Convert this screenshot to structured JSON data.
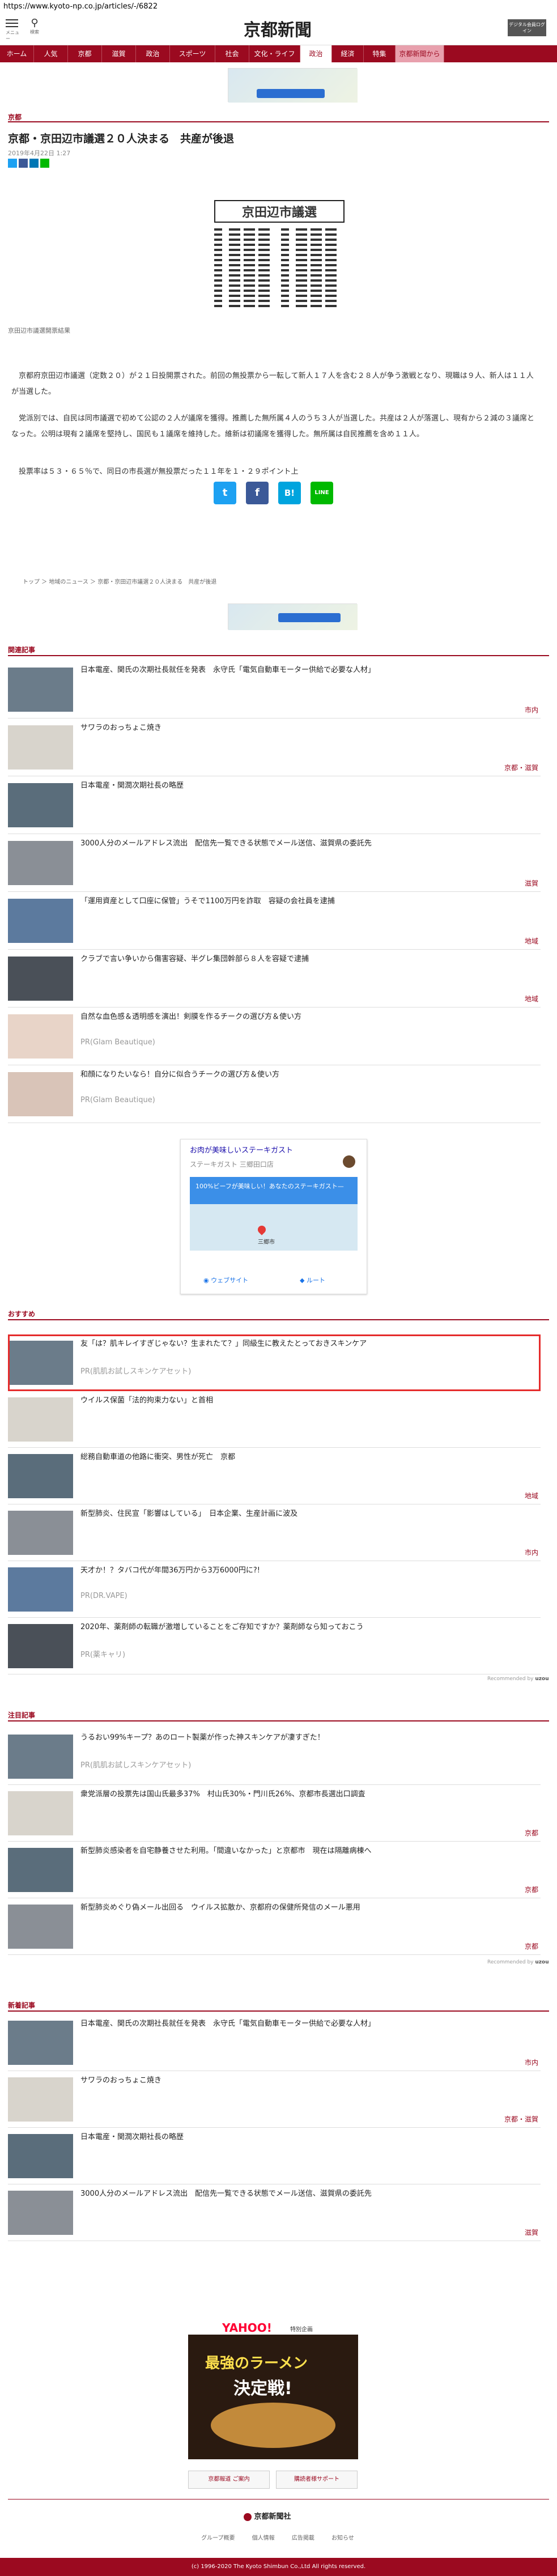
{
  "url": "https://www.kyoto-np.co.jp/articles/-/6822",
  "header": {
    "menu_label": "メニュー",
    "search_label": "検索",
    "logo": "京都新聞",
    "login_label": "デジタル会員ログイン"
  },
  "nav": [
    "ホーム",
    "人気",
    "京都",
    "滋賀",
    "政治",
    "スポーツ",
    "社会",
    "文化・ライフ",
    "政治",
    "経済",
    "特集",
    "京都新聞から"
  ],
  "breadcrumb_top": "京都",
  "article": {
    "title": "京都・京田辺市議選２０人決まる　共産が後退",
    "date": "2019年4月22日 1:27",
    "image_title": "京田辺市議選",
    "caption": "京田辺市議選開票結果",
    "paragraphs": [
      "　京都府京田辺市議選（定数２０）が２１日投開票された。前回の無投票から一転して新人１７人を含む２８人が争う激戦となり、現職は９人、新人は１１人が当選した。",
      "　党派別では、自民は同市議選で初めて公認の２人が議席を獲得。推薦した無所属４人のうち３人が当選した。共産は２人が落選し、現有から２減の３議席となった。公明は現有２議席を堅持し、国民も１議席を維持した。維新は初議席を獲得した。無所属は自民推薦を含め１１人。",
      "　投票率は５３・６５％で、同日の市長選が無投票だった１１年を１・２９ポイント上"
    ]
  },
  "share": {
    "twitter": "t",
    "facebook": "f",
    "hatena": "B!",
    "line": "LINE"
  },
  "breadcrumb": [
    "トップ",
    "地域のニュース",
    "京都・京田辺市議選２０人決まる　共産が後退"
  ],
  "related": {
    "heading": "関連記事",
    "items": [
      {
        "title": "日本電産、関氏の次期社長就任を発表　永守氏「電気自動車モーター供給で必要な人材」",
        "cat": "市内",
        "pr": ""
      },
      {
        "title": "サワラのおっちょこ焼き",
        "cat": "京都・滋賀",
        "pr": ""
      },
      {
        "title": "日本電産・関潤次期社長の略歴",
        "cat": "",
        "pr": ""
      },
      {
        "title": "3000人分のメールアドレス流出　配信先一覧できる状態でメール送信、滋賀県の委託先",
        "cat": "滋賀",
        "pr": ""
      },
      {
        "title": "「運用資産として口座に保管」うそで1100万円を詐取　容疑の会社員を逮捕",
        "cat": "地域",
        "pr": ""
      },
      {
        "title": "クラブで言い争いから傷害容疑、半グレ集団幹部ら８人を容疑で逮捕",
        "cat": "地域",
        "pr": ""
      },
      {
        "title": "自然な血色感＆透明感を演出！剣膜を作るチークの選び方＆使い方",
        "cat": "",
        "pr": "PR(Glam Beautique)"
      },
      {
        "title": "和顔になりたいなら！自分に似合うチークの選び方＆使い方",
        "cat": "",
        "pr": "PR(Glam Beautique)"
      }
    ]
  },
  "map_ad": {
    "title": "お肉が美味しいステーキガスト",
    "sub": "ステーキガスト 三郷田口店",
    "body": "100%ビーフが美味しい！あなたのステーキガスト—",
    "place": "三郷市",
    "btn1": "ウェブサイト",
    "btn2": "ルート"
  },
  "recommend": {
    "heading": "おすすめ",
    "items": [
      {
        "title": "友「は？肌キレイすぎじゃない？生まれたて？」同級生に教えたとっておきスキンケア",
        "cat": "",
        "pr": "PR(肌肌お試しスキンケアセット)"
      },
      {
        "title": "ウイルス保菌「法的拘束力ない」と首相",
        "cat": "",
        "pr": ""
      },
      {
        "title": "総務自動車道の他路に衝突、男性が死亡　京都",
        "cat": "地域",
        "pr": ""
      },
      {
        "title": "新型肺炎、住民宣「影響はしている」　日本企業、生産計画に波及",
        "cat": "市内",
        "pr": ""
      },
      {
        "title": "天才か！？タバコ代が年間36万円から3万6000円に?!",
        "cat": "",
        "pr": "PR(DR.VAPE)"
      },
      {
        "title": "2020年、薬剤師の転職が激増していることをご存知ですか？薬剤師なら知っておこう",
        "cat": "",
        "pr": "PR(薬キャリ)"
      }
    ],
    "credit": "Recommended by"
  },
  "featured": {
    "heading": "注目記事",
    "items": [
      {
        "title": "うるおい99%キープ？あのロート製薬が作った神スキンケアが凄すぎた！",
        "cat": "",
        "pr": "PR(肌肌お試しスキンケアセット)"
      },
      {
        "title": "衆党派層の投票先は国山氏最多37%　村山氏30%・門川氏26%、京都市長選出口調査",
        "cat": "京都",
        "pr": ""
      },
      {
        "title": "新型肺炎感染者を自宅静養させた利用。「間違いなかった」と京都市　現在は隔離病棟へ",
        "cat": "京都",
        "pr": ""
      },
      {
        "title": "新型肺炎めぐり偽メール出回る　ウイルス拡散か、京都府の保健所発信のメール悪用",
        "cat": "京都",
        "pr": ""
      }
    ],
    "credit": "Recommended by"
  },
  "latest": {
    "heading": "新着記事",
    "items": [
      {
        "title": "日本電産、関氏の次期社長就任を発表　永守氏「電気自動車モーター供給で必要な人材」",
        "cat": "市内",
        "pr": ""
      },
      {
        "title": "サワラのおっちょこ焼き",
        "cat": "京都・滋賀",
        "pr": ""
      },
      {
        "title": "日本電産・関潤次期社長の略歴",
        "cat": "",
        "pr": ""
      },
      {
        "title": "3000人分のメールアドレス流出　配信先一覧できる状態でメール送信、滋賀県の委託先",
        "cat": "滋賀",
        "pr": ""
      }
    ]
  },
  "yahoo_ad": {
    "brand": "YAHOO!",
    "tag": "特別企画",
    "title1": "最強の",
    "title2": "ラーメン",
    "title3": "決定戦!"
  },
  "footer": {
    "btn1": "京都報道 ご案内",
    "btn2": "購読者様サポート",
    "logo": "京都新聞社",
    "links": [
      "グループ概要",
      "個人情報",
      "広告掲載",
      "お知らせ"
    ],
    "copyright": "(c) 1996-2020 The Kyoto Shimbun Co.,Ltd All rights reserved."
  },
  "colors": {
    "brand": "#9b0a20"
  }
}
